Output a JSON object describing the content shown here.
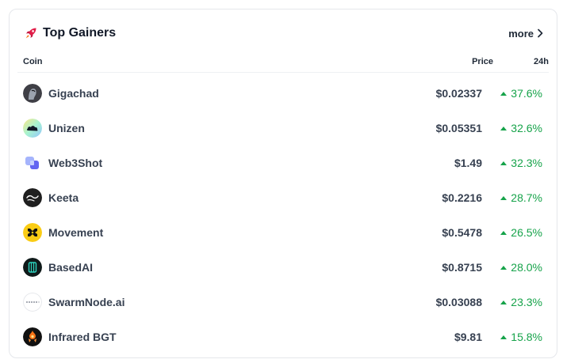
{
  "widget": {
    "title": "Top Gainers",
    "title_icon": "rocket-icon",
    "more_label": "more",
    "columns": {
      "coin": "Coin",
      "price": "Price",
      "change": "24h"
    },
    "accent_up": "#16a34a"
  },
  "coins": [
    {
      "name": "Gigachad",
      "price": "$0.02337",
      "change": "37.6%",
      "icon": "gigachad-logo"
    },
    {
      "name": "Unizen",
      "price": "$0.05351",
      "change": "32.6%",
      "icon": "unizen-logo"
    },
    {
      "name": "Web3Shot",
      "price": "$1.49",
      "change": "32.3%",
      "icon": "web3shot-logo"
    },
    {
      "name": "Keeta",
      "price": "$0.2216",
      "change": "28.7%",
      "icon": "keeta-logo"
    },
    {
      "name": "Movement",
      "price": "$0.5478",
      "change": "26.5%",
      "icon": "movement-logo"
    },
    {
      "name": "BasedAI",
      "price": "$0.8715",
      "change": "28.0%",
      "icon": "basedai-logo"
    },
    {
      "name": "SwarmNode.ai",
      "price": "$0.03088",
      "change": "23.3%",
      "icon": "swarmnode-logo"
    },
    {
      "name": "Infrared BGT",
      "price": "$9.81",
      "change": "15.8%",
      "icon": "infrared-bgt-logo"
    }
  ]
}
